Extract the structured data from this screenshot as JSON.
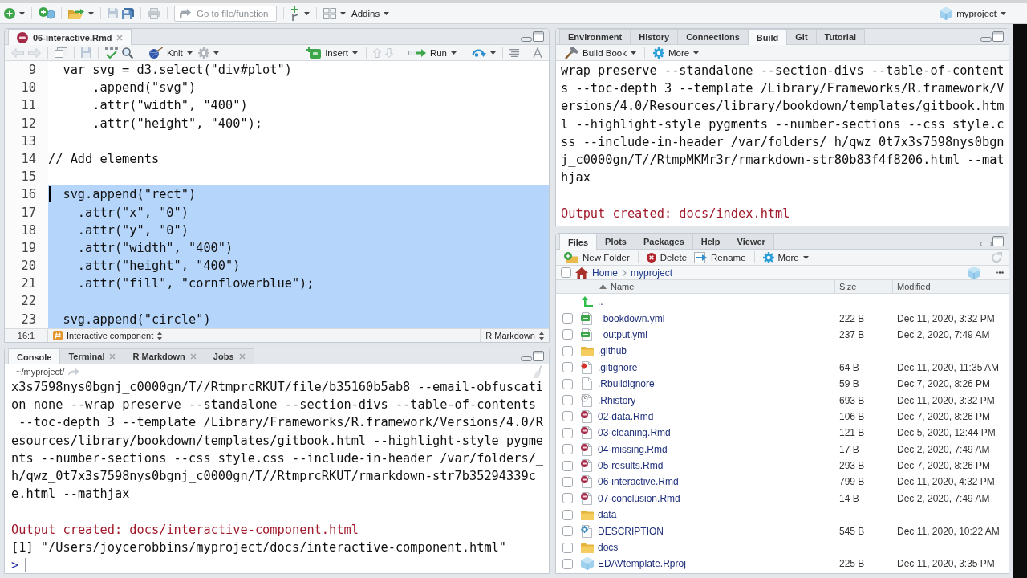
{
  "toolbar": {
    "goto": {
      "placeholder": "Go to file/function"
    },
    "addins": "Addins",
    "project": "myproject"
  },
  "editor": {
    "tabs": [
      {
        "label": "06-interactive.Rmd",
        "selected": true,
        "closable": true
      }
    ],
    "toolbar": {
      "knit": "Knit",
      "insert": "Insert",
      "run": "Run"
    },
    "lines": [
      {
        "number": "9",
        "text": "  var svg = d3.select(\"div#plot\")",
        "selected": false,
        "cursor": false
      },
      {
        "number": "10",
        "text": "      .append(\"svg\")",
        "selected": false,
        "cursor": false
      },
      {
        "number": "11",
        "text": "      .attr(\"width\", \"400\")",
        "selected": false,
        "cursor": false
      },
      {
        "number": "12",
        "text": "      .attr(\"height\", \"400\");",
        "selected": false,
        "cursor": false
      },
      {
        "number": "13",
        "selected": false,
        "cursor": false
      },
      {
        "number": "14",
        "text": "// Add elements",
        "selected": false,
        "cursor": false
      },
      {
        "number": "15",
        "selected": false,
        "cursor": false
      },
      {
        "number": "16",
        "text": "  svg.append(\"rect\")",
        "selected": true,
        "cursor": true
      },
      {
        "number": "17",
        "text": "    .attr(\"x\", \"0\")",
        "selected": true,
        "cursor": false
      },
      {
        "number": "18",
        "text": "    .attr(\"y\", \"0\")",
        "selected": true,
        "cursor": false
      },
      {
        "number": "19",
        "text": "    .attr(\"width\", \"400\")",
        "selected": true,
        "cursor": false
      },
      {
        "number": "20",
        "text": "    .attr(\"height\", \"400\")",
        "selected": true,
        "cursor": false
      },
      {
        "number": "21",
        "text": "    .attr(\"fill\", \"cornflowerblue\");",
        "selected": true,
        "cursor": false
      },
      {
        "number": "22",
        "selected": true,
        "cursor": false
      },
      {
        "number": "23",
        "text": "  svg.append(\"circle\")",
        "selected": true,
        "cursor": false
      }
    ],
    "status": {
      "position": "16:1",
      "section": "Interactive component",
      "mode": "R Markdown"
    }
  },
  "console": {
    "tabs": [
      {
        "label": "Console",
        "selected": true,
        "closable": false
      },
      {
        "label": "Terminal",
        "selected": false,
        "closable": true
      },
      {
        "label": "R Markdown",
        "selected": false,
        "closable": true
      },
      {
        "label": "Jobs",
        "selected": false,
        "closable": true
      }
    ],
    "path": "~/myproject/",
    "lines": [
      {
        "kind": "output",
        "text": "x3s7598nys0bgnj_c0000gn/T//RtmprcRKUT/file/b35160b5ab8 --email-obfuscati"
      },
      {
        "kind": "output",
        "text": "on none --wrap preserve --standalone --section-divs --table-of-contents"
      },
      {
        "kind": "output",
        "text": " --toc-depth 3 --template /Library/Frameworks/R.framework/Versions/4.0/R"
      },
      {
        "kind": "output",
        "text": "esources/library/bookdown/templates/gitbook.html --highlight-style pygme"
      },
      {
        "kind": "output",
        "text": "nts --number-sections --css style.css --include-in-header /var/folders/_"
      },
      {
        "kind": "output",
        "text": "h/qwz_0t7x3s7598nys0bgnj_c0000gn/T//RtmprcRKUT/rmarkdown-str7b35294339c"
      },
      {
        "kind": "output",
        "text": "e.html --mathjax"
      },
      {
        "kind": "blank"
      },
      {
        "kind": "message",
        "text": "Output created: docs/interactive-component.html"
      },
      {
        "kind": "output",
        "text": "[1] \"/Users/joycerobbins/myproject/docs/interactive-component.html\""
      }
    ],
    "prompt": ">"
  },
  "build": {
    "tabs": [
      {
        "label": "Environment",
        "selected": false
      },
      {
        "label": "History",
        "selected": false
      },
      {
        "label": "Connections",
        "selected": false
      },
      {
        "label": "Build",
        "selected": true
      },
      {
        "label": "Git",
        "selected": false
      },
      {
        "label": "Tutorial",
        "selected": false
      }
    ],
    "toolbar": {
      "build": "Build Book",
      "more": "More"
    },
    "lines": [
      {
        "kind": "output",
        "text": "wrap preserve --standalone --section-divs --table-of-content"
      },
      {
        "kind": "output",
        "text": "s --toc-depth 3 --template /Library/Frameworks/R.framework/V"
      },
      {
        "kind": "output",
        "text": "ersions/4.0/Resources/library/bookdown/templates/gitbook.htm"
      },
      {
        "kind": "output",
        "text": "l --highlight-style pygments --number-sections --css style.c"
      },
      {
        "kind": "output",
        "text": "ss --include-in-header /var/folders/_h/qwz_0t7x3s7598nys0bgn"
      },
      {
        "kind": "output",
        "text": "j_c0000gn/T//RtmpMKMr3r/rmarkdown-str80b83f4f8206.html --mat"
      },
      {
        "kind": "output",
        "text": "hjax"
      },
      {
        "kind": "blank"
      },
      {
        "kind": "message",
        "text": "Output created: docs/index.html"
      }
    ]
  },
  "files": {
    "tabs": [
      {
        "label": "Files",
        "selected": true
      },
      {
        "label": "Plots",
        "selected": false
      },
      {
        "label": "Packages",
        "selected": false
      },
      {
        "label": "Help",
        "selected": false
      },
      {
        "label": "Viewer",
        "selected": false
      }
    ],
    "toolbar": {
      "new_folder": "New Folder",
      "delete": "Delete",
      "rename": "Rename",
      "more": "More"
    },
    "breadcrumb": {
      "checked": false,
      "path": [
        "Home",
        "myproject"
      ]
    },
    "columns": [
      {
        "label": "Name",
        "sorted": true
      },
      {
        "label": "Size",
        "sorted": false
      },
      {
        "label": "Modified",
        "sorted": false
      }
    ],
    "rows": [
      {
        "kind": "parent",
        "name": ".."
      },
      {
        "kind": "yml",
        "name": "_bookdown.yml",
        "size": "222 B",
        "modified": "Dec 11, 2020, 3:32 PM",
        "checked": false
      },
      {
        "kind": "yml",
        "name": "_output.yml",
        "size": "237 B",
        "modified": "Dec 2, 2020, 7:49 AM",
        "checked": false
      },
      {
        "kind": "folder",
        "name": ".github",
        "checked": false
      },
      {
        "kind": "git",
        "name": ".gitignore",
        "size": "64 B",
        "modified": "Dec 11, 2020, 11:35 AM",
        "checked": false
      },
      {
        "kind": "file",
        "name": ".Rbuildignore",
        "size": "59 B",
        "modified": "Dec 7, 2020, 8:26 PM",
        "checked": false
      },
      {
        "kind": "history",
        "name": ".Rhistory",
        "size": "693 B",
        "modified": "Dec 11, 2020, 3:32 PM",
        "checked": false
      },
      {
        "kind": "rmd",
        "name": "02-data.Rmd",
        "size": "106 B",
        "modified": "Dec 7, 2020, 8:26 PM",
        "checked": false
      },
      {
        "kind": "rmd",
        "name": "03-cleaning.Rmd",
        "size": "121 B",
        "modified": "Dec 5, 2020, 12:44 PM",
        "checked": false
      },
      {
        "kind": "rmd",
        "name": "04-missing.Rmd",
        "size": "17 B",
        "modified": "Dec 2, 2020, 7:49 AM",
        "checked": false
      },
      {
        "kind": "rmd",
        "name": "05-results.Rmd",
        "size": "293 B",
        "modified": "Dec 7, 2020, 8:26 PM",
        "checked": false
      },
      {
        "kind": "rmd",
        "name": "06-interactive.Rmd",
        "size": "799 B",
        "modified": "Dec 11, 2020, 4:32 PM",
        "checked": false
      },
      {
        "kind": "rmd",
        "name": "07-conclusion.Rmd",
        "size": "14 B",
        "modified": "Dec 2, 2020, 7:49 AM",
        "checked": false
      },
      {
        "kind": "folder",
        "name": "data",
        "checked": false
      },
      {
        "kind": "description",
        "name": "DESCRIPTION",
        "size": "545 B",
        "modified": "Dec 11, 2020, 10:22 AM",
        "checked": false
      },
      {
        "kind": "folder",
        "name": "docs",
        "checked": false
      },
      {
        "kind": "rproj",
        "name": "EDAVtemplate.Rproj",
        "size": "225 B",
        "modified": "Dec 11, 2020, 3:35 PM",
        "checked": false
      }
    ]
  }
}
